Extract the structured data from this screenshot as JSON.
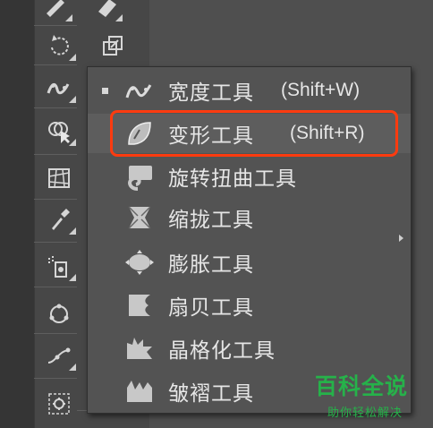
{
  "tools": {
    "rows": [
      {
        "left_icon": "pen-icon",
        "right_icon": "eraser-icon"
      },
      {
        "left_icon": "rotate-icon",
        "right_icon": "scale-icon"
      },
      {
        "left_icon": "width-tool-icon"
      },
      {
        "left_icon": "shape-builder-icon"
      },
      {
        "left_icon": "perspective-grid-icon"
      },
      {
        "left_icon": "eyedropper-icon"
      },
      {
        "left_icon": "symbol-sprayer-icon"
      },
      {
        "left_icon": "blend-icon"
      },
      {
        "left_icon": "curvature-icon"
      },
      {
        "left_icon": "artboard-icon"
      }
    ]
  },
  "flyout": {
    "items": [
      {
        "label": "宽度工具",
        "shortcut": "(Shift+W)",
        "icon": "width-tool-icon",
        "selected": true
      },
      {
        "label": "变形工具",
        "shortcut": "(Shift+R)",
        "icon": "warp-tool-icon",
        "highlighted": true
      },
      {
        "label": "旋转扭曲工具",
        "shortcut": "",
        "icon": "twirl-tool-icon"
      },
      {
        "label": "缩拢工具",
        "shortcut": "",
        "icon": "pucker-tool-icon"
      },
      {
        "label": "膨胀工具",
        "shortcut": "",
        "icon": "bloat-tool-icon"
      },
      {
        "label": "扇贝工具",
        "shortcut": "",
        "icon": "scallop-tool-icon"
      },
      {
        "label": "晶格化工具",
        "shortcut": "",
        "icon": "crystallize-tool-icon"
      },
      {
        "label": "皱褶工具",
        "shortcut": "",
        "icon": "wrinkle-tool-icon"
      }
    ]
  },
  "colors": {
    "highlight": "#ff3b0f",
    "watermark": "#26b24a"
  },
  "watermark": {
    "title": "百科全说",
    "subtitle": "助你轻松解决"
  }
}
